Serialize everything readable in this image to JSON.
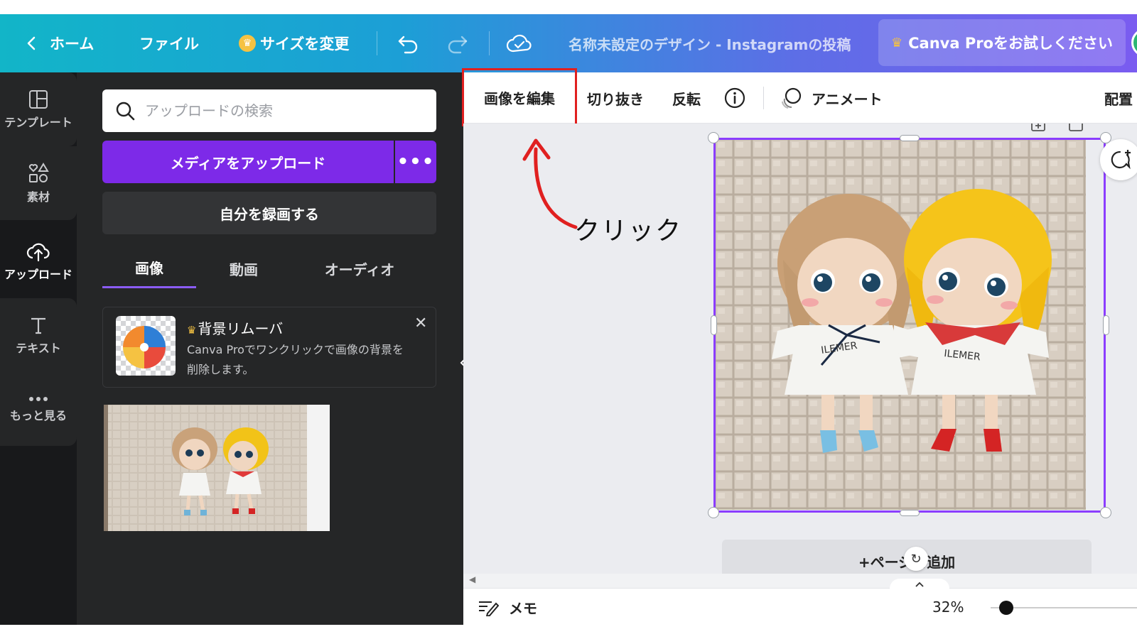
{
  "topbar": {
    "home_label": "ホーム",
    "file_label": "ファイル",
    "resize_label": "サイズを変更",
    "title": "名称未設定のデザイン - Instagramの投稿",
    "pro_label": "Canva Proをお試しください"
  },
  "rail": {
    "items": [
      {
        "label": "テンプレート",
        "icon": "template-icon"
      },
      {
        "label": "素材",
        "icon": "elements-icon"
      },
      {
        "label": "アップロード",
        "icon": "upload-cloud-icon"
      },
      {
        "label": "テキスト",
        "icon": "text-icon"
      },
      {
        "label": "もっと見る",
        "icon": "more-icon"
      }
    ],
    "active": "アップロード"
  },
  "panel": {
    "search_placeholder": "アップロードの検索",
    "upload_label": "メディアをアップロード",
    "upload_more": "•••",
    "record_label": "自分を録画する",
    "tabs": [
      "画像",
      "動画",
      "オーディオ"
    ],
    "active_tab": "画像",
    "bg_remover": {
      "title": "背景リムーバ",
      "desc": "Canva Proでワンクリックで画像の背景を削除します。"
    }
  },
  "edit_toolbar": {
    "edit_image": "画像を編集",
    "crop": "切り抜き",
    "flip": "反転",
    "animate": "アニメート",
    "position": "配置"
  },
  "canvas": {
    "add_page": "+ページを追加",
    "annotation": "クリック"
  },
  "bottombar": {
    "memo": "メモ",
    "zoom": "32%"
  },
  "colors": {
    "accent_purple": "#7d2ae8",
    "selection": "#8b3dff",
    "highlight_red": "#e02020",
    "crown_gold": "#f5c242"
  }
}
